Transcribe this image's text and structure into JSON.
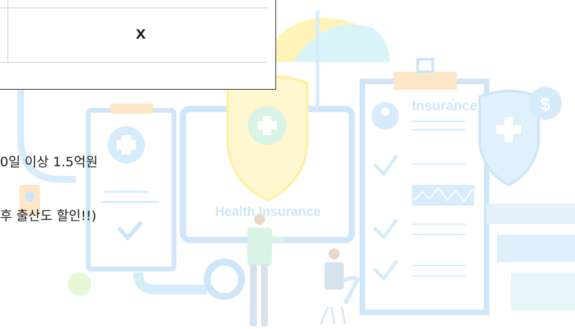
{
  "popup": {
    "close_label": "x"
  },
  "content": {
    "line1": "0일 이상 1.5억원",
    "line2": "후 출산도 할인!!)"
  },
  "illustration": {
    "insurance_label": "Insurance",
    "health_insurance_label": "Health Insurance",
    "dollar_symbol": "$",
    "icons": [
      "umbrella-icon",
      "shield-icon",
      "clipboard-icon",
      "checkmark-icon",
      "dollar-icon",
      "stethoscope-icon",
      "person-icon"
    ]
  },
  "colors": {
    "light_blue": "#d6ecfb",
    "mid_blue": "#b7dcf6",
    "light_yellow": "#fff3b8",
    "light_peach": "#fde7c8",
    "light_green": "#d9f4e6"
  }
}
